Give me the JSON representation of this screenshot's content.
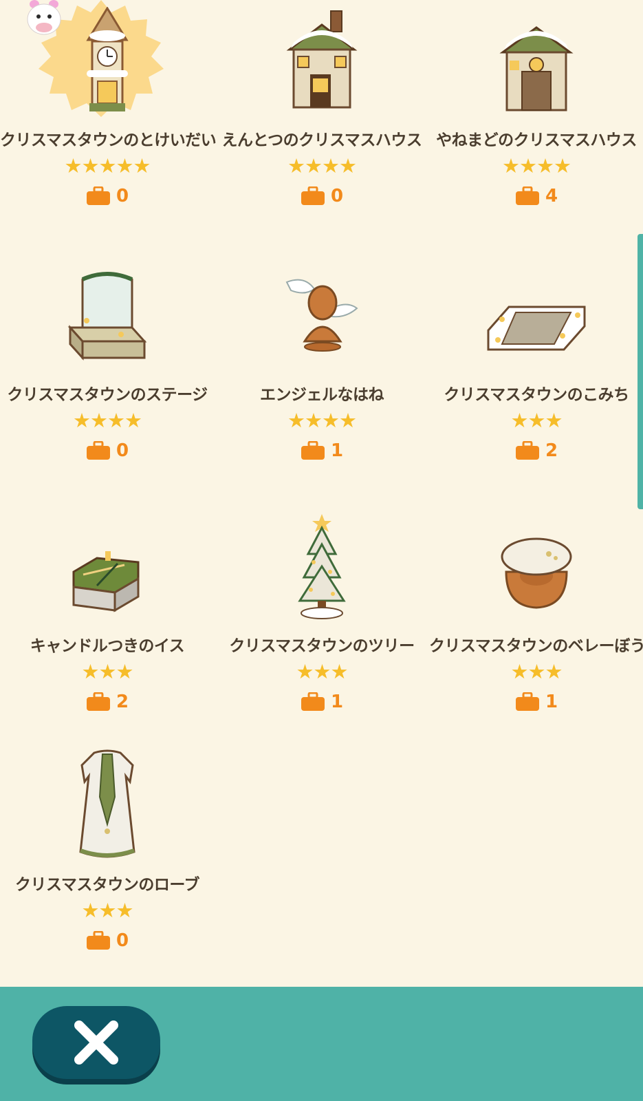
{
  "items": [
    {
      "name": "クリスマスタウンのとけいだい",
      "stars": "★★★★★",
      "count": "0",
      "icon": "clock-tower-icon"
    },
    {
      "name": "えんとつのクリスマスハウス",
      "stars": "★★★★",
      "count": "0",
      "icon": "chimney-house-icon"
    },
    {
      "name": "やねまどのクリスマスハウス",
      "stars": "★★★★",
      "count": "4",
      "icon": "dormer-house-icon"
    },
    {
      "name": "クリスマスタウンのステージ",
      "stars": "★★★★",
      "count": "0",
      "icon": "stage-icon"
    },
    {
      "name": "エンジェルなはね",
      "stars": "★★★★",
      "count": "1",
      "icon": "angel-wings-icon"
    },
    {
      "name": "クリスマスタウンのこみち",
      "stars": "★★★",
      "count": "2",
      "icon": "path-icon"
    },
    {
      "name": "キャンドルつきのイス",
      "stars": "★★★",
      "count": "2",
      "icon": "candle-chair-icon"
    },
    {
      "name": "クリスマスタウンのツリー",
      "stars": "★★★",
      "count": "1",
      "icon": "christmas-tree-icon"
    },
    {
      "name": "クリスマスタウンのベレーぼう",
      "stars": "★★★",
      "count": "1",
      "icon": "beret-icon"
    },
    {
      "name": "クリスマスタウンのローブ",
      "stars": "★★★",
      "count": "0",
      "icon": "robe-icon"
    }
  ],
  "colors": {
    "background": "#fbf5e4",
    "star": "#f6bd2a",
    "count": "#f28a1b",
    "footer": "#4fb2a7",
    "close_button": "#0d5665"
  },
  "footer": {
    "close_icon": "close-icon"
  }
}
